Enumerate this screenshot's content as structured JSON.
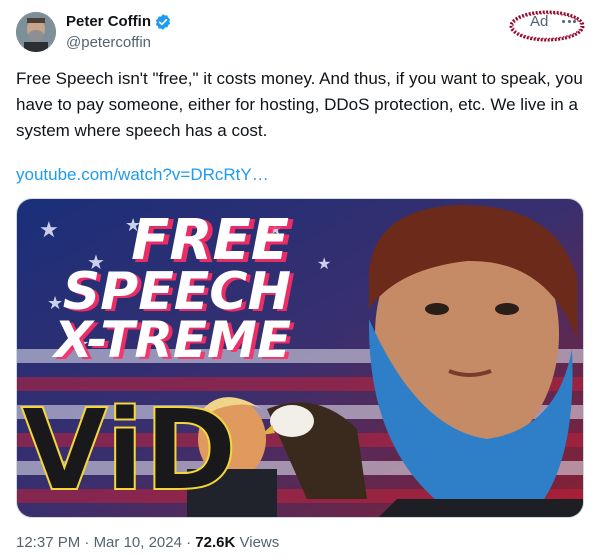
{
  "author": {
    "name": "Peter Coffin",
    "handle": "@petercoffin",
    "verified_icon": "verified-badge-icon"
  },
  "ad_label": "Ad",
  "more_icon": "more-horizontal-icon",
  "tweet": {
    "text": "Free Speech isn't \"free,\" it costs money. And thus, if you want to speak, you have to pay someone, either for hosting, DDoS protection, etc. We live in a system where speech has a cost.",
    "link": "youtube.com/watch?v=DRcRtY…"
  },
  "media": {
    "title_lines": [
      "FREE",
      "SPEECH",
      "X-TREME"
    ],
    "logo_text": "ViD"
  },
  "meta": {
    "time": "12:37 PM",
    "sep1": "·",
    "date": "Mar 10, 2024",
    "sep2": "·",
    "views_count": "72.6K",
    "views_label": "Views"
  },
  "colors": {
    "link": "#1d9bf0",
    "verified": "#1d9bf0",
    "secondary_text": "#536471",
    "ad_ring": "#8b0a2a"
  }
}
